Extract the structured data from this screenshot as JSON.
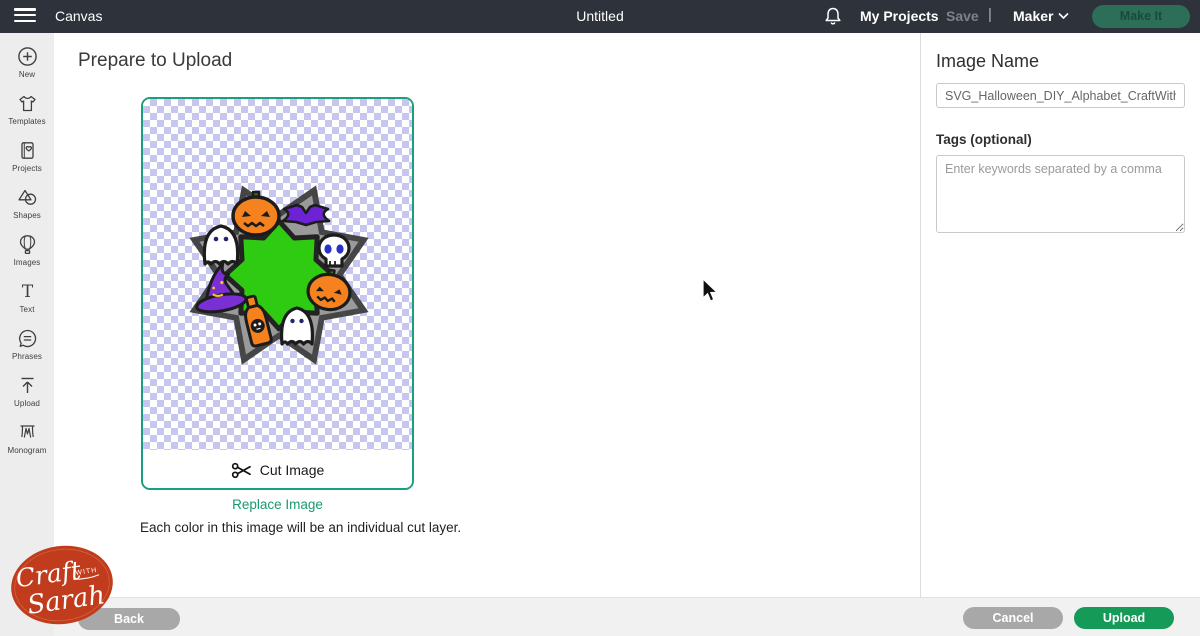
{
  "topbar": {
    "canvas_label": "Canvas",
    "document_title": "Untitled",
    "my_projects_label": "My Projects",
    "save_label": "Save",
    "separator": "|",
    "machine_name": "Maker",
    "make_it_label": "Make It"
  },
  "sidebar": {
    "items": [
      {
        "label": "New",
        "icon": "plus-circle-icon"
      },
      {
        "label": "Templates",
        "icon": "tshirt-icon"
      },
      {
        "label": "Projects",
        "icon": "notebook-heart-icon"
      },
      {
        "label": "Shapes",
        "icon": "triangle-circle-icon"
      },
      {
        "label": "Images",
        "icon": "hot-air-balloon-icon"
      },
      {
        "label": "Text",
        "icon": "letter-t-icon"
      },
      {
        "label": "Phrases",
        "icon": "speech-bubble-icon"
      },
      {
        "label": "Upload",
        "icon": "upload-arrow-icon"
      },
      {
        "label": "Monogram",
        "icon": "monogram-icon"
      }
    ]
  },
  "main": {
    "heading": "Prepare to Upload",
    "cut_image_label": "Cut Image",
    "replace_image_label": "Replace Image",
    "description": "Each color in this image will be an individual cut layer.",
    "preview_image": "halloween-wreath-svg-with-transparent-checkerboard"
  },
  "right_panel": {
    "image_name_label": "Image Name",
    "image_name_value": "SVG_Halloween_DIY_Alphabet_CraftWithSara",
    "tags_label": "Tags (optional)",
    "tags_placeholder": "Enter keywords separated by a comma"
  },
  "footer": {
    "back_label": "Back",
    "cancel_label": "Cancel",
    "upload_label": "Upload"
  },
  "logo": {
    "craft": "Craft",
    "with": "WITH",
    "sarah": "Sarah"
  },
  "colors": {
    "topbar_bg": "#2e333b",
    "make_it_bg": "#2d6e59",
    "card_border": "#18a17c",
    "replace_link": "#179a70",
    "upload_btn": "#169a57",
    "gray_btn": "#a8a8a8",
    "checker": "#c6c6ee",
    "logo_red": "#c13b1d",
    "wreath_green": "#2fca12",
    "wreath_gray": "#9a9a9a",
    "pumpkin_orange": "#f6821f",
    "bat_purple": "#6d22d6"
  }
}
